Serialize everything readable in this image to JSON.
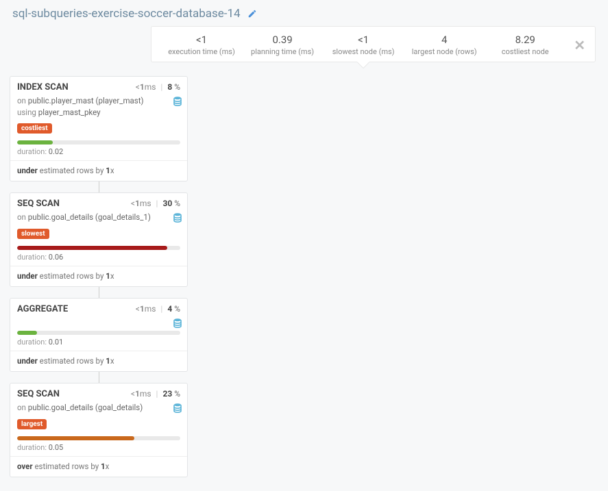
{
  "header": {
    "title": "sql-subqueries-exercise-soccer-database-14"
  },
  "stats": {
    "exec_val": "<1",
    "exec_label": "execution time (ms)",
    "plan_val": "0.39",
    "plan_label": "planning time (ms)",
    "slow_val": "<1",
    "slow_label": "slowest node (ms)",
    "large_val": "4",
    "large_label": "largest node (rows)",
    "cost_val": "8.29",
    "cost_label": "costliest node"
  },
  "nodes": {
    "n0": {
      "title": "INDEX SCAN",
      "time_prefix": "<",
      "time_num": "1",
      "time_unit": "ms",
      "pct": "8",
      "on_kw": "on",
      "on_val": "public.player_mast (player_mast)",
      "using_kw": "using",
      "using_val": "player_mast_pkey",
      "badge": "costliest",
      "bar_color": "#6bb33f",
      "bar_width": "22%",
      "dur_label": "duration:",
      "dur_val": "0.02",
      "est_b1": "under",
      "est_mid": " estimated rows by ",
      "est_b2": "1",
      "est_tail": "x"
    },
    "n1": {
      "title": "SEQ SCAN",
      "time_prefix": "<",
      "time_num": "1",
      "time_unit": "ms",
      "pct": "30",
      "on_kw": "on",
      "on_val": "public.goal_details (goal_details_1)",
      "badge": "slowest",
      "bar_color": "#a71b1b",
      "bar_width": "92%",
      "dur_label": "duration:",
      "dur_val": "0.06",
      "est_b1": "under",
      "est_mid": " estimated rows by ",
      "est_b2": "1",
      "est_tail": "x"
    },
    "n2": {
      "title": "AGGREGATE",
      "time_prefix": "<",
      "time_num": "1",
      "time_unit": "ms",
      "pct": "4",
      "bar_color": "#6bb33f",
      "bar_width": "12%",
      "dur_label": "duration:",
      "dur_val": "0.01",
      "est_b1": "under",
      "est_mid": " estimated rows by ",
      "est_b2": "1",
      "est_tail": "x"
    },
    "n3": {
      "title": "SEQ SCAN",
      "time_prefix": "<",
      "time_num": "1",
      "time_unit": "ms",
      "pct": "23",
      "on_kw": "on",
      "on_val": "public.goal_details (goal_details)",
      "badge": "largest",
      "bar_color": "#c9681c",
      "bar_width": "72%",
      "dur_label": "duration:",
      "dur_val": "0.05",
      "est_b1": "over",
      "est_mid": " estimated rows by ",
      "est_b2": "1",
      "est_tail": "x"
    }
  }
}
